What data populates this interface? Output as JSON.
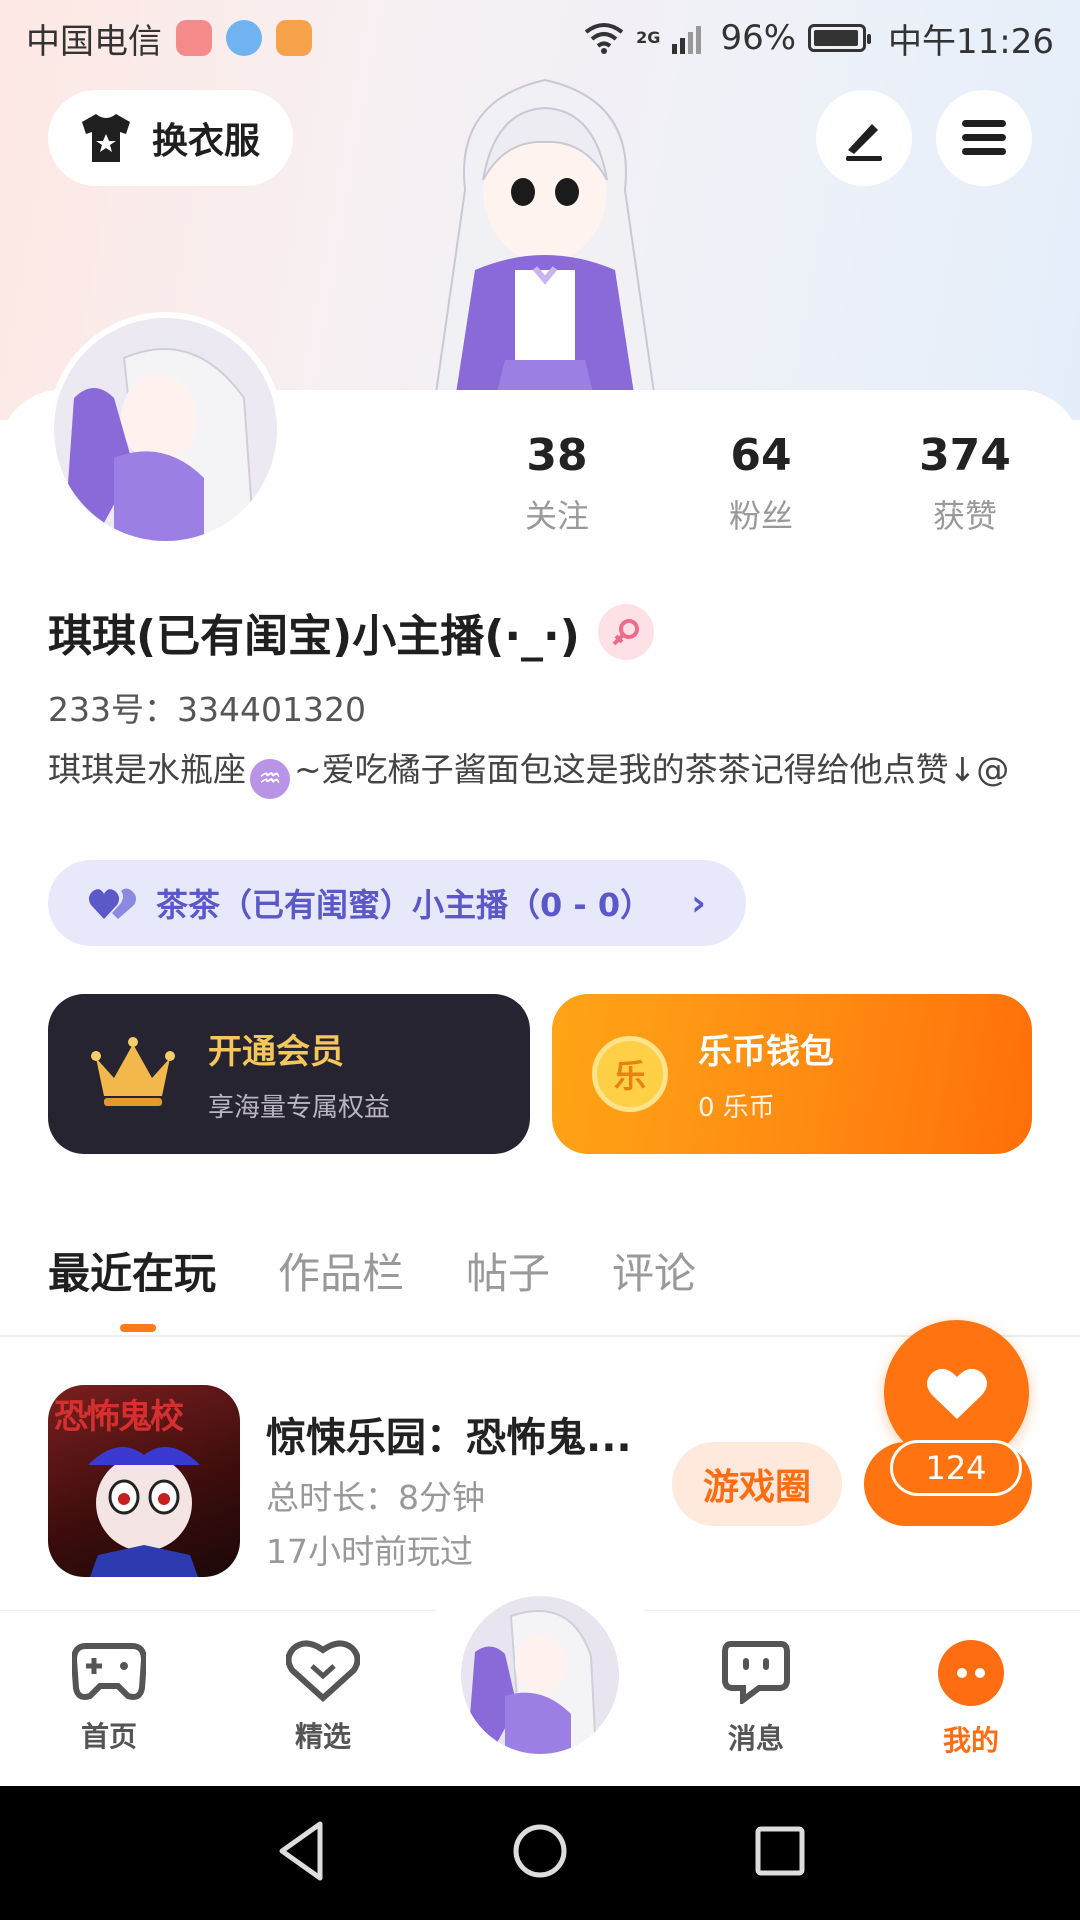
{
  "status_bar": {
    "carrier": "中国电信",
    "network": "2G",
    "battery_percent": "96%",
    "time": "中午11:26",
    "battery_level": 0.96
  },
  "header": {
    "outfit_label": "换衣服"
  },
  "profile": {
    "stats": [
      {
        "value": "38",
        "label": "关注"
      },
      {
        "value": "64",
        "label": "粉丝"
      },
      {
        "value": "374",
        "label": "获赞"
      }
    ],
    "nickname": "琪琪(已有闺宝)小主播(·_·)",
    "user_id": "233号：334401320",
    "bio_part1": "琪琪是水瓶座",
    "zodiac_glyph": "♒",
    "bio_part2": "~爱吃橘子酱面包这是我的茶茶记得给他点赞↓@",
    "bestie_label": "茶茶（已有闺蜜）小主播（0 - 0）"
  },
  "cards": {
    "vip": {
      "title": "开通会员",
      "subtitle": "享海量专属权益"
    },
    "wallet": {
      "title": "乐币钱包",
      "subtitle": "0 乐币",
      "coin_glyph": "乐"
    }
  },
  "tabs": [
    "最近在玩",
    "作品栏",
    "帖子",
    "评论"
  ],
  "game": {
    "title": "惊悚乐园：恐怖鬼...",
    "icon_text": "恐怖鬼校",
    "duration": "总时长：8分钟",
    "last_played": "17小时前玩过",
    "circle_button": "游戏圈"
  },
  "likes": {
    "count": "124"
  },
  "bottom_nav": [
    {
      "label": "首页",
      "icon": "gamepad-icon"
    },
    {
      "label": "精选",
      "icon": "heart-chat-icon"
    },
    {
      "label": "消息",
      "icon": "message-icon"
    },
    {
      "label": "我的",
      "icon": "more-dots-icon"
    }
  ],
  "colors": {
    "accent": "#ff7410",
    "bestie_text": "#5b58c9",
    "vip_bg": "#272432",
    "vip_title": "#f5c65a"
  }
}
